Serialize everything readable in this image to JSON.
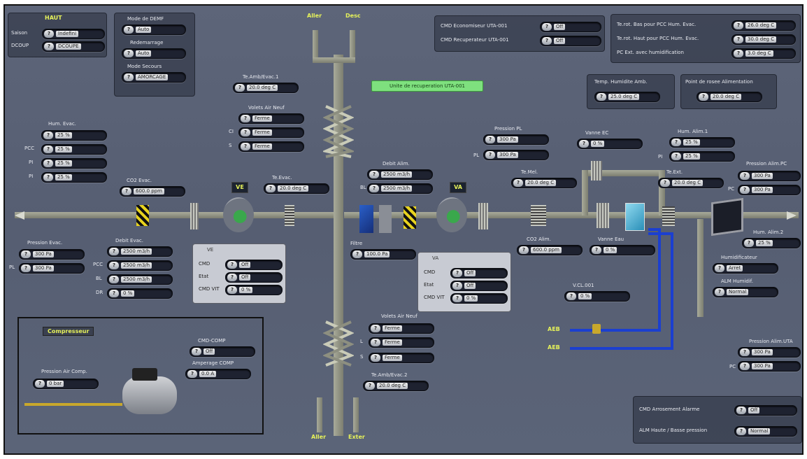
{
  "top_left": {
    "title": "HAUT",
    "rows": [
      {
        "label": "Saison",
        "value": "Indefini"
      },
      {
        "label": "DCOUP",
        "value": "DCOUPE"
      }
    ]
  },
  "mode_panel": {
    "labels": [
      "Mode de DEMF",
      "Redemarrage",
      "Mode Secours"
    ],
    "values": [
      "Auto",
      "Auto",
      "AMORCAGE"
    ]
  },
  "air_labels": {
    "top_left": "Aller",
    "top_right": "Desc",
    "bottom_left": "Aller",
    "bottom_right": "Exter"
  },
  "cmd_panel": {
    "rows": [
      {
        "label": "CMD Economiseur UTA-001",
        "value": "Off"
      },
      {
        "label": "CMD Recuperateur UTA-001",
        "value": "Off"
      }
    ]
  },
  "setpoint_panel": {
    "rows": [
      {
        "label": "Te.rot. Bas pour PCC Hum. Evac.",
        "value": "26.0 deg C"
      },
      {
        "label": "Te.rot. Haut pour PCC Hum. Evac.",
        "value": "30.0 deg C"
      },
      {
        "label": "PC Ext. avec humidification",
        "value": "3.0 deg C"
      }
    ]
  },
  "green_status": "Unite de recuperation UTA-001",
  "temp_hum": {
    "label": "Temp. Humidite Amb.",
    "value": "25.0 deg C"
  },
  "point_rosee": {
    "label": "Point de rosee Alimentation",
    "value": "20.0 deg C"
  },
  "evac_temp": {
    "label": "Te.Amb/Evac.1",
    "value": "20.0 deg C"
  },
  "volet_evac": {
    "label": "Volets Air Neuf",
    "rows": [
      {
        "label": "",
        "value": "Ferme"
      },
      {
        "label": "CI",
        "value": "Ferme"
      },
      {
        "label": "S",
        "value": "Ferme"
      }
    ]
  },
  "hum_evac": {
    "label": "Hum. Evac.",
    "rows": [
      {
        "label": "",
        "value": "25 %"
      },
      {
        "label": "PCC",
        "value": "25 %"
      },
      {
        "label": "PI",
        "value": "25 %"
      },
      {
        "label": "PI",
        "value": "25 %"
      }
    ]
  },
  "co2_evac": {
    "label": "CO2 Evac.",
    "value": "600.0 ppm"
  },
  "te_evac": {
    "label": "Te.Evac.",
    "value": "20.0 deg C"
  },
  "badge_left": "VE",
  "badge_right": "VA",
  "pression_evac": {
    "label": "Pression Evac.",
    "rows": [
      {
        "label": "",
        "value": "300 Pa"
      },
      {
        "label": "PL",
        "value": "300 Pa"
      }
    ]
  },
  "debit_evac": {
    "label": "Debit Evac.",
    "rows": [
      {
        "label": "",
        "value": "2500 m3/h"
      },
      {
        "label": "PCC",
        "value": "2500 m3/h"
      },
      {
        "label": "BL",
        "value": "2500 m3/h"
      },
      {
        "label": "DR",
        "value": "0 %"
      }
    ]
  },
  "fan_left": {
    "title": "VE",
    "rows": [
      {
        "label": "CMD",
        "value": "Off"
      },
      {
        "label": "Etat",
        "value": "Off"
      },
      {
        "label": "CMD VIT",
        "value": "0 %"
      }
    ]
  },
  "debit_alim": {
    "label": "Debit Alim.",
    "rows": [
      {
        "label": "",
        "value": "2500 m3/h"
      },
      {
        "label": "BL",
        "value": "2500 m3/h"
      }
    ]
  },
  "filtre": {
    "label": "Filtre",
    "value": "100.0 Pa"
  },
  "fan_right": {
    "title": "VA",
    "rows": [
      {
        "label": "CMD",
        "value": "Off"
      },
      {
        "label": "Etat",
        "value": "Off"
      },
      {
        "label": "CMD VIT",
        "value": "0 %"
      }
    ]
  },
  "pression_pl": {
    "label": "Pression PL",
    "rows": [
      {
        "label": "",
        "value": "300 Pa"
      },
      {
        "label": "PL",
        "value": "300 Pa"
      }
    ]
  },
  "te_melange": {
    "label": "Te.Mel.",
    "value": "20.0 deg C"
  },
  "vanne_ec": {
    "label": "Vanne EC",
    "value": "0 %"
  },
  "hum_alim1": {
    "label": "Hum. Alim.1",
    "rows": [
      {
        "label": "",
        "value": "25 %"
      },
      {
        "label": "PI",
        "value": "25 %"
      }
    ]
  },
  "te_ext": {
    "label": "Te.Ext.",
    "value": "20.0 deg C"
  },
  "pression_alim": {
    "label": "Pression Alim.PC",
    "rows": [
      {
        "label": "",
        "value": "300 Pa"
      },
      {
        "label": "PC",
        "value": "300 Pa"
      }
    ]
  },
  "co2_alim": {
    "label": "CO2 Alim.",
    "value": "600.0 ppm"
  },
  "vanne_eau": {
    "label": "Vanne Eau",
    "value": "0 %"
  },
  "hum_alim2": {
    "label": "Hum. Alim.2",
    "value": "25 %"
  },
  "humidificateur": {
    "label": "Humidificateur",
    "value": "Arret"
  },
  "alm_humidif": {
    "label": "ALM Humidif.",
    "value": "Normal"
  },
  "vcl": {
    "label": "V.CL.001",
    "value": "0 %"
  },
  "water_labels": [
    "AEB",
    "AEB"
  ],
  "volet_alim": {
    "label": "Volets Air Neuf",
    "rows": [
      {
        "label": "",
        "value": "Ferme"
      },
      {
        "label": "L",
        "value": "Ferme"
      },
      {
        "label": "S",
        "value": "Ferme"
      }
    ]
  },
  "te_amb2": {
    "label": "Te.Amb/Evac.2",
    "value": "20.0 deg C"
  },
  "pression_alim2": {
    "label": "Pression Alim.UTA",
    "rows": [
      {
        "label": "",
        "value": "300 Pa"
      },
      {
        "label": "PC",
        "value": "300 Pa"
      }
    ]
  },
  "compresseur": {
    "title": "Compresseur",
    "cmd": {
      "label": "CMD-COMP",
      "value": "Off"
    },
    "amp": {
      "label": "Amperage COMP",
      "value": "0.0 A"
    },
    "pression": {
      "label": "Pression Air Comp.",
      "value": "0 bar"
    }
  },
  "bottom_right": {
    "rows": [
      {
        "label": "CMD Arrosement Alarme",
        "value": "Off"
      },
      {
        "label": "ALM Haute / Basse pression",
        "value": "Normal"
      }
    ]
  }
}
